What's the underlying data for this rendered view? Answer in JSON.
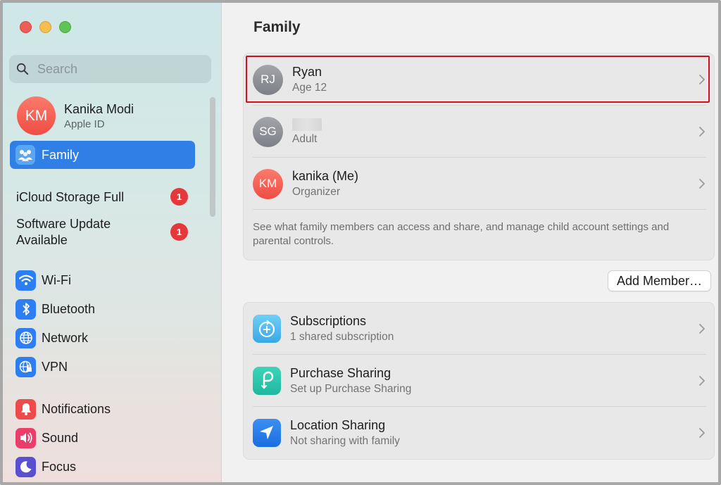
{
  "sidebar": {
    "search_placeholder": "Search",
    "account": {
      "initials": "KM",
      "name": "Kanika Modi",
      "subtitle": "Apple ID"
    },
    "family_label": "Family",
    "alerts": [
      {
        "label": "iCloud Storage Full",
        "badge": "1"
      },
      {
        "label_line1": "Software Update",
        "label_line2": "Available",
        "badge": "1"
      }
    ],
    "network_items": [
      {
        "label": "Wi-Fi",
        "icon": "wifi-icon"
      },
      {
        "label": "Bluetooth",
        "icon": "bluetooth-icon"
      },
      {
        "label": "Network",
        "icon": "globe-icon"
      },
      {
        "label": "VPN",
        "icon": "vpn-icon"
      }
    ],
    "system_items": [
      {
        "label": "Notifications",
        "icon": "bell-icon"
      },
      {
        "label": "Sound",
        "icon": "speaker-icon"
      },
      {
        "label": "Focus",
        "icon": "moon-icon"
      }
    ]
  },
  "main": {
    "title": "Family",
    "members": [
      {
        "initials": "RJ",
        "name": "Ryan",
        "role": "Age 12",
        "highlighted": true
      },
      {
        "initials": "SG",
        "name": "",
        "role": "Adult"
      },
      {
        "initials": "KM",
        "name": "kanika (Me)",
        "role": "Organizer"
      }
    ],
    "footnote": "See what family members can access and share, and manage child account settings and parental controls.",
    "add_member_label": "Add Member…",
    "services": [
      {
        "title": "Subscriptions",
        "subtitle": "1 shared subscription",
        "icon": "subscriptions-icon"
      },
      {
        "title": "Purchase Sharing",
        "subtitle": "Set up Purchase Sharing",
        "icon": "purchase-sharing-icon"
      },
      {
        "title": "Location Sharing",
        "subtitle": "Not sharing with family",
        "icon": "location-arrow-icon"
      }
    ]
  },
  "colors": {
    "accent": "#2f7fe6",
    "badge_red": "#e5383b",
    "highlight_red": "#d0101e"
  }
}
